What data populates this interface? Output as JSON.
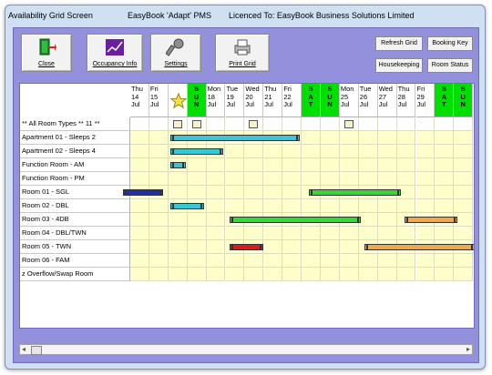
{
  "titlebar": {
    "screen": "Availability Grid Screen",
    "product": "EasyBook 'Adapt' PMS",
    "licence": "Licenced To: EasyBook Business Solutions Limited"
  },
  "toolbar": {
    "close_label": "Close",
    "occupancy_label": "Occupancy Info",
    "settings_label": "Settings",
    "print_label": "Print Grid",
    "refresh_label": "Refresh Grid",
    "booking_key_label": "Booking Key",
    "housekeeping_label": "Housekeeping",
    "room_status_label": "Room Status"
  },
  "days": [
    {
      "dow": "Thu",
      "day": "14",
      "mon": "Jul",
      "weekend": false
    },
    {
      "dow": "Fri",
      "day": "15",
      "mon": "Jul",
      "weekend": false
    },
    {
      "dow": "",
      "day": "",
      "mon": "",
      "weekend": false,
      "today": true
    },
    {
      "dow": "S",
      "day": "U",
      "mon": "N",
      "weekend": true
    },
    {
      "dow": "Mon",
      "day": "18",
      "mon": "Jul",
      "weekend": false
    },
    {
      "dow": "Tue",
      "day": "19",
      "mon": "Jul",
      "weekend": false
    },
    {
      "dow": "Wed",
      "day": "20",
      "mon": "Jul",
      "weekend": false
    },
    {
      "dow": "Thu",
      "day": "21",
      "mon": "Jul",
      "weekend": false
    },
    {
      "dow": "Fri",
      "day": "22",
      "mon": "Jul",
      "weekend": false
    },
    {
      "dow": "S",
      "day": "A",
      "mon": "T",
      "weekend": true
    },
    {
      "dow": "S",
      "day": "U",
      "mon": "N",
      "weekend": true
    },
    {
      "dow": "Mon",
      "day": "25",
      "mon": "Jul",
      "weekend": false
    },
    {
      "dow": "Tue",
      "day": "26",
      "mon": "Jul",
      "weekend": false
    },
    {
      "dow": "Wed",
      "day": "27",
      "mon": "Jul",
      "weekend": false
    },
    {
      "dow": "Thu",
      "day": "28",
      "mon": "Jul",
      "weekend": false
    },
    {
      "dow": "Fri",
      "day": "29",
      "mon": "Jul",
      "weekend": false
    },
    {
      "dow": "S",
      "day": "A",
      "mon": "T",
      "weekend": true
    },
    {
      "dow": "S",
      "day": "U",
      "mon": "N",
      "weekend": true
    }
  ],
  "rows": [
    "** All Room Types ** 11 **",
    "Apartment 01 - Sleeps 2",
    "Apartment 02 - Sleeps 4",
    "Function Room - AM",
    "Function Room - PM",
    "Room 01 - SGL",
    "Room 02 - DBL",
    "Room 03 - 4DB",
    "Room 04 - DBL/TWN",
    "Room 05 - TWN",
    "Room 06 - FAM",
    "z Overflow/Swap Room"
  ],
  "colors": {
    "cyan_bar": "#37c8d8",
    "green_bar": "#36d836",
    "red_bar": "#e01818",
    "orange_bar": "#f0a848",
    "blue_bar": "#1e2fa8"
  }
}
